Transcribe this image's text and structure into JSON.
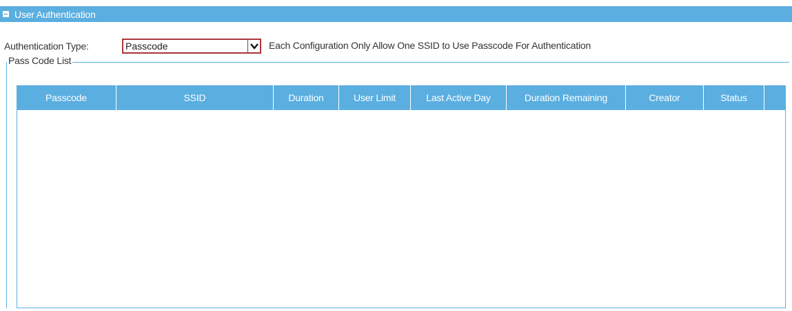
{
  "section": {
    "title": "User Authentication",
    "collapse_icon": "collapse-minus-icon"
  },
  "auth": {
    "label": "Authentication Type:",
    "selected": "Passcode",
    "arrow_icon": "chevron-down-icon",
    "note": "Each Configuration Only Allow One SSID to Use Passcode For Authentication"
  },
  "group": {
    "legend": "Pass Code List"
  },
  "table": {
    "columns": [
      "Passcode",
      "SSID",
      "Duration",
      "User Limit",
      "Last Active Day",
      "Duration Remaining",
      "Creator",
      "Status",
      ""
    ],
    "rows": []
  },
  "colors": {
    "accent": "#5aaee0",
    "select_border": "#a8343a"
  }
}
